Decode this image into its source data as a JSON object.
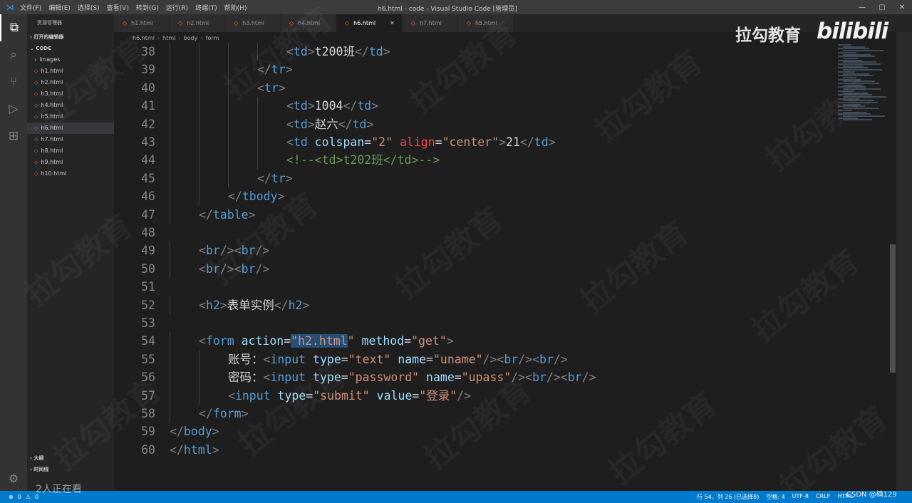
{
  "titlebar": {
    "menus": [
      "文件(F)",
      "编辑(E)",
      "选择(S)",
      "查看(V)",
      "转到(G)",
      "运行(R)",
      "终端(T)",
      "帮助(H)"
    ],
    "title": "h6.html - code - Visual Studio Code [管理员]",
    "window_controls": [
      "—",
      "▢",
      "✕"
    ]
  },
  "sidebar": {
    "header": "资源管理器",
    "open_editors": "打开的编辑器",
    "folder": "CODE",
    "files": [
      "images",
      "h1.html",
      "h2.html",
      "h3.html",
      "h4.html",
      "h5.html",
      "h6.html",
      "h7.html",
      "h8.html",
      "h9.html",
      "h10.html"
    ],
    "outline": "大纲",
    "timeline": "时间线"
  },
  "tabs": [
    "h1.html",
    "h2.html",
    "h3.html",
    "h4.html",
    "h6.html",
    "h7.html",
    "h5.html"
  ],
  "active_tab": "h6.html",
  "breadcrumb": [
    "h6.html",
    "html",
    "body",
    "form"
  ],
  "overlay": {
    "brand": "拉勾教育",
    "bili": "bilibili",
    "viewers": "2人正在看",
    "watermark": "拉勾教育"
  },
  "status": {
    "errors": "0",
    "warnings": "0",
    "position": "行 54，列 26 (已选择8)",
    "spaces": "空格: 4",
    "encoding": "UTF-8",
    "eol": "CRLF",
    "language": "HTML",
    "csdn": "CSDN @楠129"
  },
  "editor": {
    "lines": [
      {
        "n": "38",
        "indent": 4,
        "tokens": [
          [
            "p",
            "<"
          ],
          [
            "t",
            "td"
          ],
          [
            "p",
            ">"
          ],
          [
            "x",
            "t200班"
          ],
          [
            "p",
            "</"
          ],
          [
            "t",
            "td"
          ],
          [
            "p",
            ">"
          ]
        ]
      },
      {
        "n": "39",
        "indent": 3,
        "tokens": [
          [
            "p",
            "</"
          ],
          [
            "t",
            "tr"
          ],
          [
            "p",
            ">"
          ]
        ]
      },
      {
        "n": "40",
        "indent": 3,
        "tokens": [
          [
            "p",
            "<"
          ],
          [
            "t",
            "tr"
          ],
          [
            "p",
            ">"
          ]
        ]
      },
      {
        "n": "41",
        "indent": 4,
        "tokens": [
          [
            "p",
            "<"
          ],
          [
            "t",
            "td"
          ],
          [
            "p",
            ">"
          ],
          [
            "x",
            "1004"
          ],
          [
            "p",
            "</"
          ],
          [
            "t",
            "td"
          ],
          [
            "p",
            ">"
          ]
        ]
      },
      {
        "n": "42",
        "indent": 4,
        "tokens": [
          [
            "p",
            "<"
          ],
          [
            "t",
            "td"
          ],
          [
            "p",
            ">"
          ],
          [
            "x",
            "赵六"
          ],
          [
            "p",
            "</"
          ],
          [
            "t",
            "td"
          ],
          [
            "p",
            ">"
          ]
        ]
      },
      {
        "n": "43",
        "indent": 4,
        "tokens": [
          [
            "p",
            "<"
          ],
          [
            "t",
            "td"
          ],
          [
            "x",
            " "
          ],
          [
            "a",
            "colspan"
          ],
          [
            "x",
            "="
          ],
          [
            "s",
            "\"2\""
          ],
          [
            "x",
            " "
          ],
          [
            "r",
            "align"
          ],
          [
            "x",
            "="
          ],
          [
            "s",
            "\"center\""
          ],
          [
            "p",
            ">"
          ],
          [
            "x",
            "21"
          ],
          [
            "p",
            "</"
          ],
          [
            "t",
            "td"
          ],
          [
            "p",
            ">"
          ]
        ]
      },
      {
        "n": "44",
        "indent": 4,
        "tokens": [
          [
            "c",
            "<!--<td>t202班</td>-->"
          ]
        ]
      },
      {
        "n": "45",
        "indent": 3,
        "tokens": [
          [
            "p",
            "</"
          ],
          [
            "t",
            "tr"
          ],
          [
            "p",
            ">"
          ]
        ]
      },
      {
        "n": "46",
        "indent": 2,
        "tokens": [
          [
            "p",
            "</"
          ],
          [
            "t",
            "tbody"
          ],
          [
            "p",
            ">"
          ]
        ]
      },
      {
        "n": "47",
        "indent": 1,
        "tokens": [
          [
            "p",
            "</"
          ],
          [
            "t",
            "table"
          ],
          [
            "p",
            ">"
          ]
        ]
      },
      {
        "n": "48",
        "indent": 0,
        "tokens": []
      },
      {
        "n": "49",
        "indent": 1,
        "tokens": [
          [
            "p",
            "<"
          ],
          [
            "t",
            "br"
          ],
          [
            "p",
            "/><"
          ],
          [
            "t",
            "br"
          ],
          [
            "p",
            "/>"
          ]
        ]
      },
      {
        "n": "50",
        "indent": 1,
        "tokens": [
          [
            "p",
            "<"
          ],
          [
            "t",
            "br"
          ],
          [
            "p",
            "/><"
          ],
          [
            "t",
            "br"
          ],
          [
            "p",
            "/>"
          ]
        ]
      },
      {
        "n": "51",
        "indent": 0,
        "tokens": []
      },
      {
        "n": "52",
        "indent": 1,
        "tokens": [
          [
            "p",
            "<"
          ],
          [
            "t",
            "h2"
          ],
          [
            "p",
            ">"
          ],
          [
            "x",
            "表单实例"
          ],
          [
            "p",
            "</"
          ],
          [
            "t",
            "h2"
          ],
          [
            "p",
            ">"
          ]
        ]
      },
      {
        "n": "53",
        "indent": 0,
        "tokens": []
      },
      {
        "n": "54",
        "indent": 1,
        "tokens": [
          [
            "p",
            "<"
          ],
          [
            "t",
            "form"
          ],
          [
            "x",
            " "
          ],
          [
            "a",
            "action"
          ],
          [
            "x",
            "="
          ],
          [
            "sel",
            "\"h2.html"
          ],
          [
            "s",
            "\""
          ],
          [
            "x",
            " "
          ],
          [
            "a",
            "method"
          ],
          [
            "x",
            "="
          ],
          [
            "s",
            "\"get\""
          ],
          [
            "p",
            ">"
          ]
        ]
      },
      {
        "n": "55",
        "indent": 2,
        "tokens": [
          [
            "x",
            "账号："
          ],
          [
            "p",
            "<"
          ],
          [
            "t",
            "input"
          ],
          [
            "x",
            " "
          ],
          [
            "a",
            "type"
          ],
          [
            "x",
            "="
          ],
          [
            "s",
            "\"text\""
          ],
          [
            "x",
            " "
          ],
          [
            "a",
            "name"
          ],
          [
            "x",
            "="
          ],
          [
            "s",
            "\"uname\""
          ],
          [
            "p",
            "/><"
          ],
          [
            "t",
            "br"
          ],
          [
            "p",
            "/><"
          ],
          [
            "t",
            "br"
          ],
          [
            "p",
            "/>"
          ]
        ]
      },
      {
        "n": "56",
        "indent": 2,
        "tokens": [
          [
            "x",
            "密码："
          ],
          [
            "p",
            "<"
          ],
          [
            "t",
            "input"
          ],
          [
            "x",
            " "
          ],
          [
            "a",
            "type"
          ],
          [
            "x",
            "="
          ],
          [
            "s",
            "\"password\""
          ],
          [
            "x",
            " "
          ],
          [
            "a",
            "name"
          ],
          [
            "x",
            "="
          ],
          [
            "s",
            "\"upass\""
          ],
          [
            "p",
            "/><"
          ],
          [
            "t",
            "br"
          ],
          [
            "p",
            "/><"
          ],
          [
            "t",
            "br"
          ],
          [
            "p",
            "/>"
          ]
        ]
      },
      {
        "n": "57",
        "indent": 2,
        "tokens": [
          [
            "p",
            "<"
          ],
          [
            "t",
            "input"
          ],
          [
            "x",
            " "
          ],
          [
            "a",
            "type"
          ],
          [
            "x",
            "="
          ],
          [
            "s",
            "\"submit\""
          ],
          [
            "x",
            " "
          ],
          [
            "a",
            "value"
          ],
          [
            "x",
            "="
          ],
          [
            "s",
            "\"登录\""
          ],
          [
            "p",
            "/>"
          ]
        ]
      },
      {
        "n": "58",
        "indent": 1,
        "tokens": [
          [
            "p",
            "</"
          ],
          [
            "t",
            "form"
          ],
          [
            "p",
            ">"
          ]
        ]
      },
      {
        "n": "59",
        "indent": 0,
        "tokens": [
          [
            "p",
            "</"
          ],
          [
            "t",
            "body"
          ],
          [
            "p",
            ">"
          ]
        ]
      },
      {
        "n": "60",
        "indent": 0,
        "tokens": [
          [
            "p",
            "</"
          ],
          [
            "t",
            "html"
          ],
          [
            "p",
            ">"
          ]
        ]
      }
    ]
  }
}
